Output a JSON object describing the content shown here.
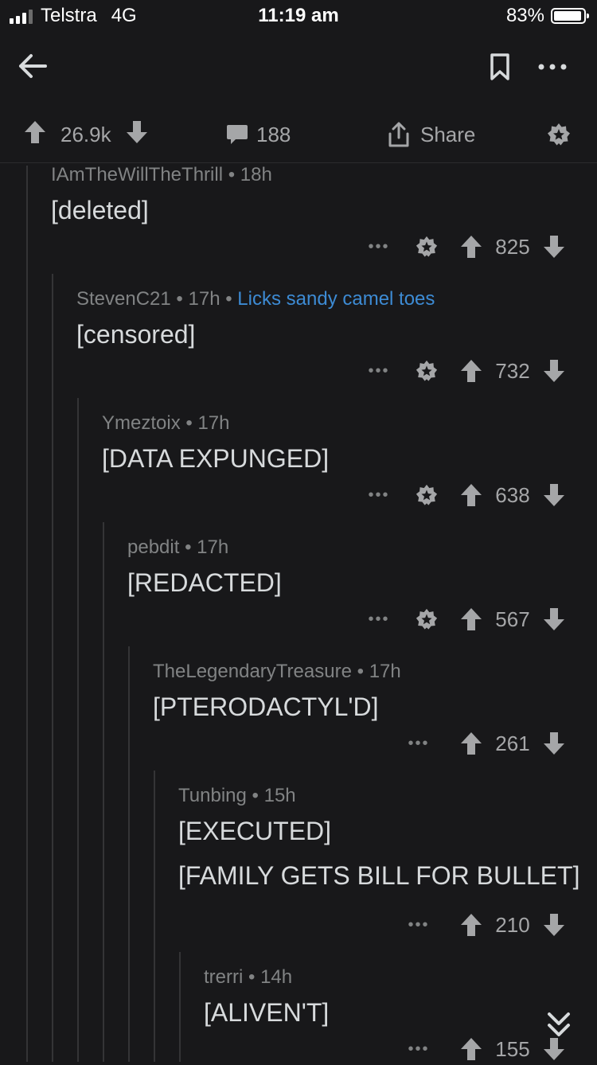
{
  "status": {
    "carrier": "Telstra",
    "network": "4G",
    "time": "11:19 am",
    "battery": "83%"
  },
  "post_actions": {
    "upvotes": "26.9k",
    "comments": "188",
    "share_label": "Share"
  },
  "comments": [
    {
      "author": "IAmTheWillTheThrill",
      "age": "18h",
      "flair": "",
      "body": [
        "[deleted]"
      ],
      "score": "825",
      "award": true
    },
    {
      "author": "StevenC21",
      "age": "17h",
      "flair": "Licks sandy camel toes",
      "body": [
        "[censored]"
      ],
      "score": "732",
      "award": true
    },
    {
      "author": "Ymeztoix",
      "age": "17h",
      "flair": "",
      "body": [
        "[DATA EXPUNGED]"
      ],
      "score": "638",
      "award": true
    },
    {
      "author": "pebdit",
      "age": "17h",
      "flair": "",
      "body": [
        "[REDACTED]"
      ],
      "score": "567",
      "award": true
    },
    {
      "author": "TheLegendaryTreasure",
      "age": "17h",
      "flair": "",
      "body": [
        "[PTERODACTYL'D]"
      ],
      "score": "261",
      "award": false
    },
    {
      "author": "Tunbing",
      "age": "15h",
      "flair": "",
      "body": [
        "[EXECUTED]",
        "[FAMILY GETS BILL FOR BULLET]"
      ],
      "score": "210",
      "award": false
    },
    {
      "author": "trerri",
      "age": "14h",
      "flair": "",
      "body": [
        "[ALIVEN'T]"
      ],
      "score": "155",
      "award": false
    }
  ],
  "colors": {
    "background": "#18181a",
    "text": "#d7dadc",
    "meta": "#818384",
    "flair": "#3d8bd4",
    "thread_line": "#343436"
  },
  "icons": [
    "back-arrow-icon",
    "bookmark-icon",
    "more-options-icon",
    "upvote-icon",
    "downvote-icon",
    "comment-icon",
    "share-icon",
    "award-icon",
    "collapse-chevron-icon"
  ]
}
